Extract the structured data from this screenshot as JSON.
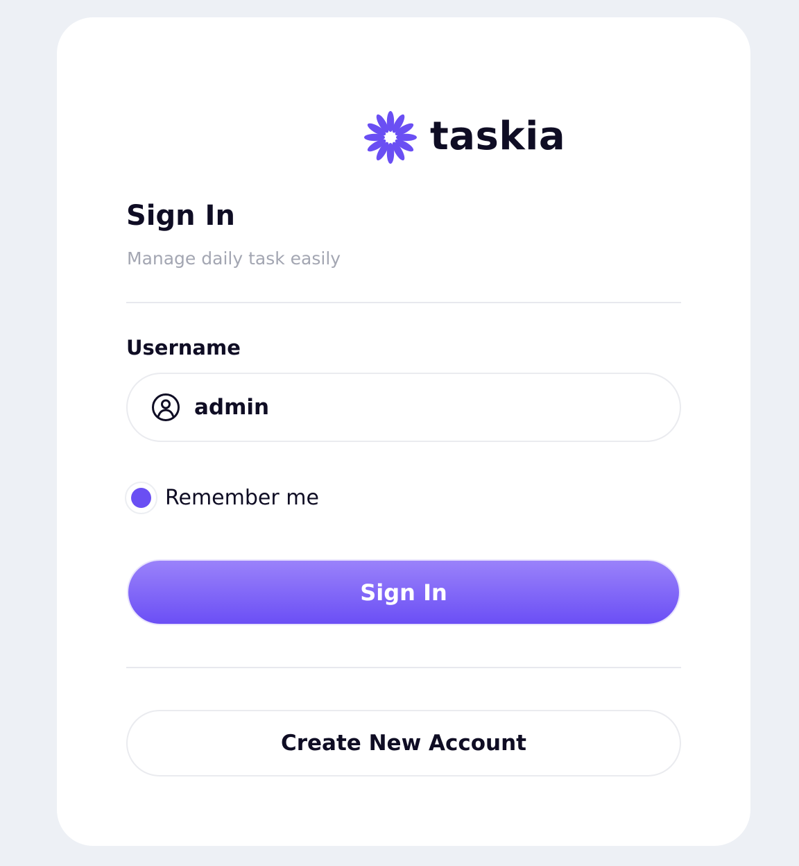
{
  "colors": {
    "page_background": "#edf0f5",
    "card_background": "#ffffff",
    "accent": "#6a4ff3",
    "text_primary": "#0f0d24",
    "text_muted": "#a3a6b2"
  },
  "brand": {
    "name": "taskia",
    "logo_icon": "flower-burst-icon"
  },
  "signin": {
    "title": "Sign In",
    "subtitle": "Manage daily task easily"
  },
  "username": {
    "label": "Username",
    "value": "admin",
    "icon": "user-circle-icon"
  },
  "remember": {
    "label": "Remember me",
    "checked": true
  },
  "buttons": {
    "signin_label": "Sign In",
    "create_account_label": "Create New Account"
  }
}
